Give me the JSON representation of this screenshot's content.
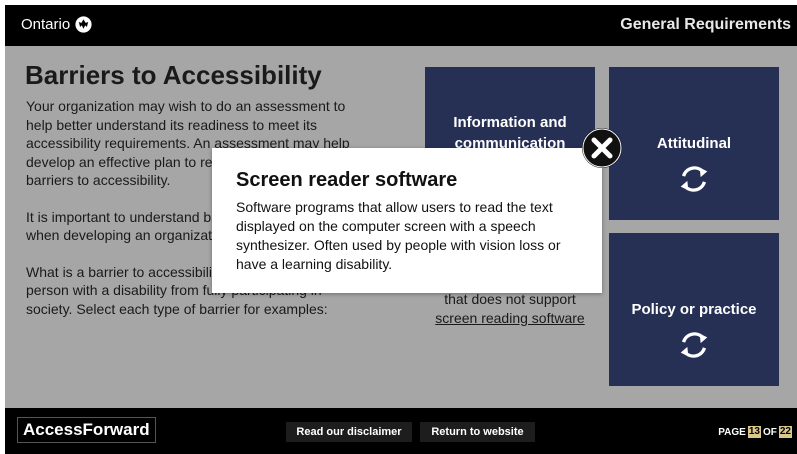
{
  "header": {
    "brand": "Ontario",
    "section_title": "General Requirements"
  },
  "main": {
    "heading": "Barriers to Accessibility",
    "paragraphs": [
      "Your organization may wish to do an assessment to help better understand its readiness to meet its accessibility requirements. An assessment may help develop an effective plan to remove and prevent barriers to accessibility.",
      "It is important to understand barriers to accessibility when developing an organization's plan.",
      "What is a barrier to accessibility? A barrier prevents a person with a disability from fully participating in society. Select each type of barrier for examples:"
    ]
  },
  "cards": {
    "info": {
      "title": "Information and communication",
      "example_lead": "that does not support",
      "example_link": "screen reading software"
    },
    "attitudinal": {
      "title": "Attitudinal"
    },
    "policy": {
      "title": "Policy or practice"
    },
    "refresh_icon": "refresh-icon"
  },
  "modal": {
    "title": "Screen reader software",
    "body": "Software programs that allow users to read the text displayed on the computer screen with a speech synthesizer. Often used by people with vision loss or have a learning disability."
  },
  "footer": {
    "logo": "AccessForward",
    "disclaimer_label": "Read our disclaimer",
    "return_label": "Return to website",
    "page_label": "PAGE",
    "page_current": "13",
    "page_of": "OF",
    "page_total": "22"
  },
  "colors": {
    "card_navy": "#263055",
    "stage_grey": "#a6a6a6",
    "bar_black": "#000000"
  }
}
